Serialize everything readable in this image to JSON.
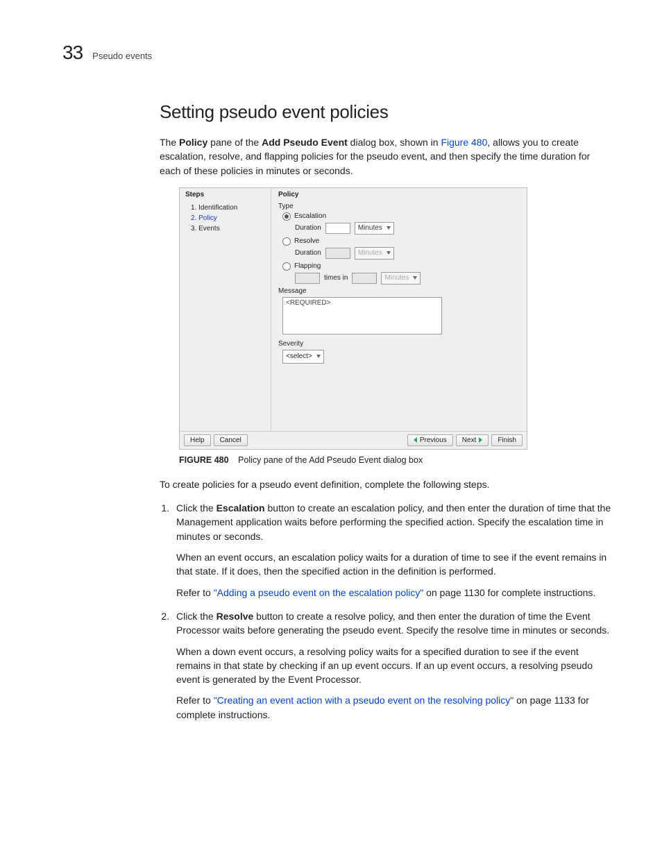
{
  "header": {
    "chapter_number": "33",
    "running_head": "Pseudo events"
  },
  "heading": "Setting pseudo event policies",
  "intro": {
    "pre1": "The ",
    "bold1": "Policy",
    "mid1": " pane of the ",
    "bold2": "Add Pseudo Event",
    "mid2": " dialog box, shown in ",
    "figref": "Figure 480",
    "post": ", allows you to create escalation, resolve, and flapping policies for the pseudo event, and then specify the time duration for each of these policies in minutes or seconds."
  },
  "dialog": {
    "steps_title": "Steps",
    "policy_title": "Policy",
    "steps": [
      "1. Identification",
      "2. Policy",
      "3. Events"
    ],
    "type_label": "Type",
    "radios": {
      "escalation": "Escalation",
      "resolve": "Resolve",
      "flapping": "Flapping"
    },
    "duration_label": "Duration",
    "times_in_label": "times in",
    "unit_value": "Minutes",
    "message_label": "Message",
    "message_placeholder": "<REQUIRED>",
    "severity_label": "Severity",
    "severity_value": "<select>",
    "buttons": {
      "help": "Help",
      "cancel": "Cancel",
      "previous": "Previous",
      "next": "Next",
      "finish": "Finish"
    }
  },
  "figure": {
    "number": "FIGURE 480",
    "caption": "Policy pane of the Add Pseudo Event dialog box"
  },
  "lead_in": "To create policies for a pseudo event definition, complete the following steps.",
  "step1": {
    "pre": "Click the ",
    "bold": "Escalation",
    "post": " button to create an escalation policy, and then enter the duration of time that the Management application waits before performing the specified action. Specify the escalation time in minutes or seconds.",
    "para2": "When an event occurs, an escalation policy waits for a duration of time to see if the event remains in that state. If it does, then the specified action in the definition is performed.",
    "refer_pre": "Refer to ",
    "refer_link": "\"Adding a pseudo event on the escalation policy\"",
    "refer_post": " on page 1130 for complete instructions."
  },
  "step2": {
    "pre": "Click the ",
    "bold": "Resolve",
    "post": " button to create a resolve policy, and then enter the duration of time the Event Processor waits before generating the pseudo event. Specify the resolve time in minutes or seconds.",
    "para2": "When a down event occurs, a resolving policy waits for a specified duration to see if the event remains in that state by checking if an up event occurs. If an up event occurs, a resolving pseudo event is generated by the Event Processor.",
    "refer_pre": "Refer to ",
    "refer_link": "\"Creating an event action with a pseudo event on the resolving policy\"",
    "refer_post": " on page 1133 for complete instructions."
  }
}
